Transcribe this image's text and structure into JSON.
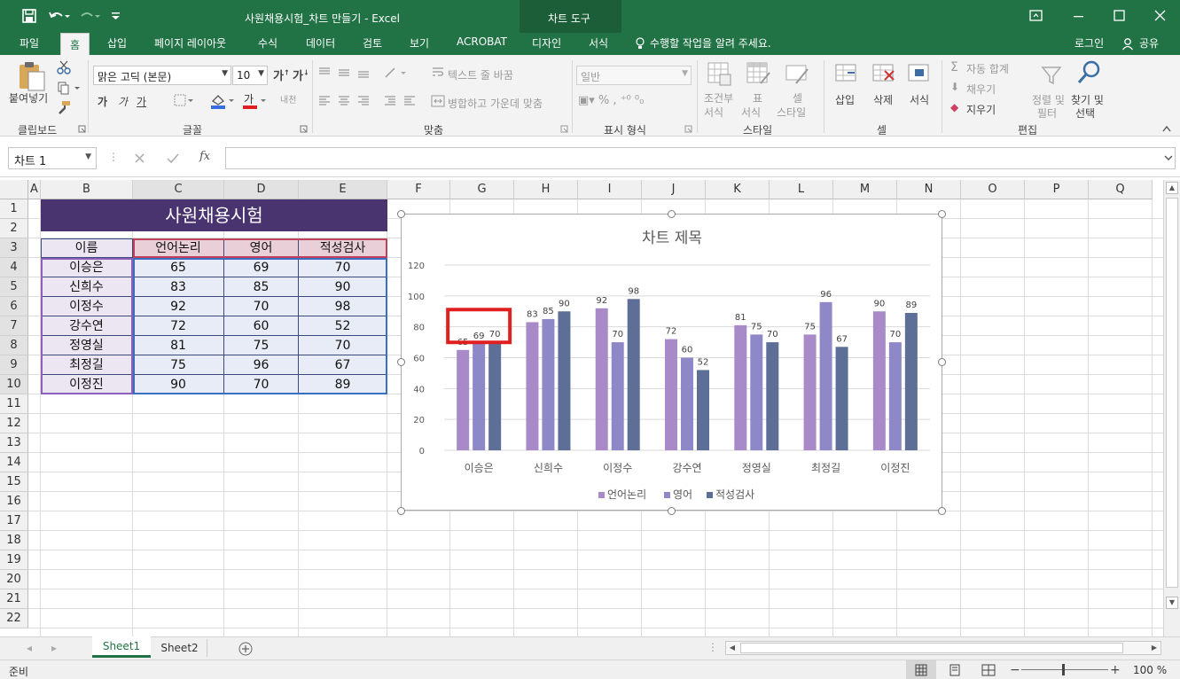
{
  "window": {
    "title": "사원채용시험_차트 만들기 - Excel",
    "context_tab_group": "차트 도구"
  },
  "ribbon_tabs": [
    "파일",
    "홈",
    "삽입",
    "페이지 레이아웃",
    "수식",
    "데이터",
    "검토",
    "보기",
    "ACROBAT",
    "디자인",
    "서식"
  ],
  "tell_me": "수행할 작업을 알려 주세요.",
  "login": "로그인",
  "share": "공유",
  "ribbon": {
    "clipboard": {
      "paste": "붙여넣기",
      "group": "클립보드"
    },
    "font": {
      "name": "맑은 고딕 (본문)",
      "size": "10",
      "group": "글꼴"
    },
    "alignment": {
      "wrap": "텍스트 줄 바꿈",
      "merge": "병합하고 가운데 맞춤",
      "group": "맞춤"
    },
    "number": {
      "format": "일반",
      "group": "표시 형식"
    },
    "styles": {
      "conditional": "조건부",
      "conditional2": "서식",
      "table": "표",
      "table2": "서식",
      "cell": "셀",
      "cell2": "스타일",
      "group": "스타일"
    },
    "cells": {
      "insert": "삽입",
      "delete": "삭제",
      "format": "서식",
      "group": "셀"
    },
    "editing": {
      "autosum": "자동 합계",
      "fill": "채우기",
      "clear": "지우기",
      "sort": "정렬 및",
      "sort2": "필터",
      "find": "찾기 및",
      "find2": "선택",
      "group": "편집"
    }
  },
  "namebox": "차트 1",
  "columns": [
    "A",
    "B",
    "C",
    "D",
    "E",
    "F",
    "G",
    "H",
    "I",
    "J",
    "K",
    "L",
    "M",
    "N",
    "O",
    "P",
    "Q"
  ],
  "rows": [
    "1",
    "2",
    "3",
    "4",
    "5",
    "6",
    "7",
    "8",
    "9",
    "10",
    "11",
    "12",
    "13",
    "14",
    "15",
    "16",
    "17",
    "18",
    "19",
    "20",
    "21",
    "22"
  ],
  "sheet": {
    "title": "사원채용시험",
    "headers": [
      "이름",
      "언어논리",
      "영어",
      "적성검사"
    ],
    "data": [
      [
        "이승은",
        "65",
        "69",
        "70"
      ],
      [
        "신희수",
        "83",
        "85",
        "90"
      ],
      [
        "이정수",
        "92",
        "70",
        "98"
      ],
      [
        "강수연",
        "72",
        "60",
        "52"
      ],
      [
        "정영실",
        "81",
        "75",
        "70"
      ],
      [
        "최정길",
        "75",
        "96",
        "67"
      ],
      [
        "이정진",
        "90",
        "70",
        "89"
      ]
    ]
  },
  "chart_data": {
    "type": "bar",
    "title": "차트 제목",
    "categories": [
      "이승은",
      "신희수",
      "이정수",
      "강수연",
      "정영실",
      "최정길",
      "이정진"
    ],
    "series": [
      {
        "name": "언어논리",
        "values": [
          65,
          83,
          92,
          72,
          81,
          75,
          90
        ],
        "color": "#a98ac8"
      },
      {
        "name": "영어",
        "values": [
          69,
          85,
          70,
          60,
          75,
          96,
          70
        ],
        "color": "#8f88c8"
      },
      {
        "name": "적성검사",
        "values": [
          70,
          90,
          98,
          52,
          70,
          67,
          89
        ],
        "color": "#5e6f97"
      }
    ],
    "yticks": [
      "0",
      "20",
      "40",
      "60",
      "80",
      "100",
      "120"
    ],
    "ylim": [
      0,
      120
    ],
    "grid": true,
    "legend_position": "bottom",
    "highlight_category": "이승은",
    "highlight_color": "#e02020"
  },
  "sheet_tabs": [
    "Sheet1",
    "Sheet2"
  ],
  "status": {
    "ready": "준비",
    "zoom": "100 %"
  },
  "colors": {
    "accent": "#217346",
    "title_band": "#4a3470",
    "header_fill": "#e8cfd8",
    "name_fill": "#ece6f3",
    "data_fill": "#e8ecf7"
  }
}
